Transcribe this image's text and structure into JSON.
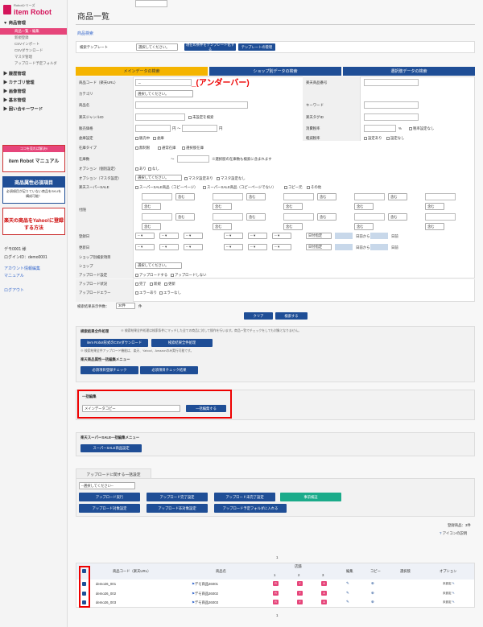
{
  "logo": {
    "series": "Robotシリーズ",
    "name": "item Robot"
  },
  "nav": [
    {
      "label": "▼ 商品管理",
      "subs": [
        "商品一覧・編集",
        "新規登録",
        "CSVインポート",
        "CSVダウンロード",
        "マスタ管理",
        "アップロード予定フォルダ"
      ],
      "active": 0
    },
    {
      "label": "▶ 履歴管理"
    },
    {
      "label": "▶ カテゴリ管理"
    },
    {
      "label": "▶ 画像管理"
    },
    {
      "label": "▶ 基本管理"
    },
    {
      "label": "▶ 困い合キーワード"
    }
  ],
  "banners": {
    "b1_top": "ココを見れば解決!!",
    "b1_main": "item Robot マニュアル",
    "b2_main": "商品属性必須項目",
    "b2_sub": "必須項目が足りていない商品をSKUを構成可能！",
    "b3_main": "楽天の商品をYahoo!に登録する方法"
  },
  "user": {
    "name": "デモ0001 様",
    "login": "ログインID：demo0001",
    "account": "アカウント情報編集",
    "manual": "マニュアル",
    "logout": "ログアウト"
  },
  "page_title": "商品一覧",
  "search_title": "商品検索",
  "template": {
    "label": "検索テンプレート",
    "select": "選択してください。",
    "btn_save": "現在の条件をテンプレート化する",
    "btn_manage": "テンプレートの管理"
  },
  "tabs": [
    "メインデータの検索",
    "ショップ別データの検索",
    "選択肢データの検索"
  ],
  "annotation": "_(アンダーバー)",
  "form": {
    "code_label": "商品コード（楽天URL）",
    "code_value": "_",
    "rakuten_no": "楽天商品番号",
    "category": "カテゴリ",
    "category_select": "選択してください。",
    "product_name": "商品名",
    "keyword": "キーワード",
    "genre_id": "楽天ジャンルID",
    "genre_unset": "未設定を検索",
    "tag_id": "楽天タグID",
    "price": "販売価格",
    "yen": "円",
    "tilde": "〜",
    "tax_rate": "消費税率",
    "tax_unit": "%",
    "tax_incl": "税率設定なし",
    "warehouse": "倉庫設定",
    "wh_opt1": "販売中",
    "wh_opt2": "倉庫",
    "reduced": "軽減税率",
    "red_opt1": "設定あり",
    "red_opt2": "設定なし",
    "stock_type": "在庫タイプ",
    "st_opt1": "無制限",
    "st_opt2": "通常在庫",
    "st_opt3": "選択肢在庫",
    "stock_qty": "在庫数",
    "stock_note": "※選択肢の在庫数も検索に含まれます",
    "option_single": "オプション（個別設定）",
    "opt_yes": "あり",
    "opt_no": "なし",
    "option_master": "オプション（マスタ設定）",
    "master_select": "選択してください。",
    "master_yes": "マスタ設定あり",
    "master_no": "マスタ設定なし",
    "super_sale": "楽天スーパーSALE",
    "ss_opt1": "スーパーSALE商品（コピーページ）",
    "ss_opt2": "スーパーSALE商品（コピーページでない）",
    "ss_opt3": "コピー元",
    "ss_opt4": "その他",
    "flag": "付随",
    "contains": "含む",
    "reg_date": "登録日",
    "upd_date": "更新日",
    "date_sep": "-- ▾",
    "date_spec": "日付指定",
    "days_from": "日前から",
    "days_unit": "日前",
    "shop_item": "ショップ別検索項目",
    "shop": "ショップ",
    "shop_select": "選択してください。",
    "upload_set": "アップロード設定",
    "up_opt1": "アップロードする",
    "up_opt2": "アップロードしない",
    "upload_status": "アップロード状況",
    "us_opt1": "完了",
    "us_opt2": "新規",
    "us_opt3": "更新",
    "upload_error": "アップロードエラー",
    "ue_opt1": "エラーあり",
    "ue_opt2": "エラーなし"
  },
  "count_label": "検索結果表示件数：",
  "count_select": "30件",
  "count_unit": "件",
  "btn_clear": "クリア",
  "btn_search": "検索する",
  "bulk": {
    "title": "検索結果全件処理",
    "note1": "※ 検索結果全件処理は検索条件にマッチした全ての商品に対して操作を行います。商品一覧でチェックをしても対象となりません。",
    "btn_csv": "item Robot形式のCSVダウンロード",
    "btn_all": "検索結果全件処理",
    "note2": "※ 検索結果全件アップロード機能は、楽天、Yahoo!、Amazonのみ実行可能です。",
    "menu": "楽天商品属性一括編集メニュー",
    "btn_check": "必須項目登録チェック",
    "btn_result": "必須項目チェック結果"
  },
  "edit": {
    "title": "一括編集",
    "select": "メインデータコピー",
    "btn": "一括編集する"
  },
  "ss_menu": {
    "title": "楽天スーパーSALE一括編集メニュー",
    "btn": "スーパーSALE商品設定"
  },
  "upload": {
    "tab": "アップロードに関する一括設定",
    "select": "--選択してください--",
    "b1": "アップロード実行",
    "b2": "アップロード完了設定",
    "b3": "アップロード未完了設定",
    "b4": "事前検証",
    "b5": "アップロード対象設定",
    "b6": "アップロード非対象設定",
    "b7": "アップロード予定フォルダに入れる"
  },
  "reg_count": "登録商品：3件",
  "icon_help": "アイコンの説明",
  "page_no": "1",
  "table": {
    "headers": [
      "商品コード（楽天URL）",
      "商品名",
      "店舗",
      "編集",
      "コピー",
      "選択肢",
      "オプション"
    ],
    "shop_cols": [
      "1",
      "2",
      "3"
    ],
    "rows": [
      {
        "code": "demo26_001",
        "name": "デモ商品26001",
        "opt": "未設定"
      },
      {
        "code": "demo26_002",
        "name": "デモ商品26002",
        "opt": "未設定"
      },
      {
        "code": "demo26_003",
        "name": "デモ商品26003",
        "opt": "未設定"
      }
    ]
  },
  "colors": {
    "accent": "#e6457a",
    "navy": "#1f4e96",
    "tab_active": "#f5b400",
    "red": "#e00000",
    "green": "#1bab8a"
  }
}
